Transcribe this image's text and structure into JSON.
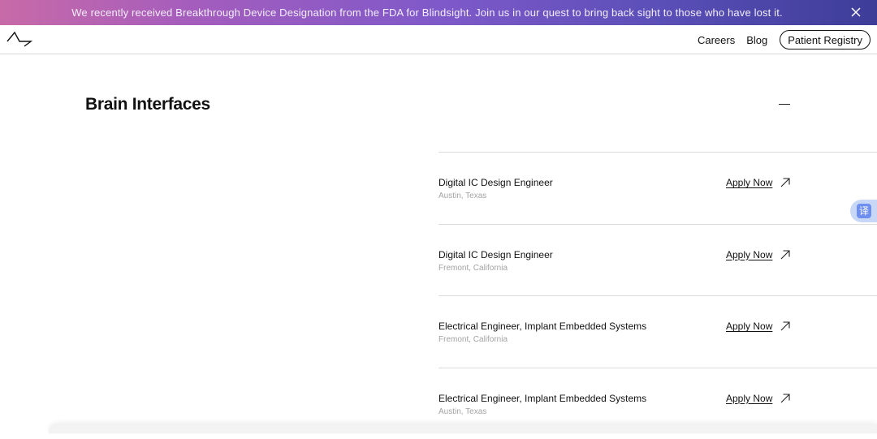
{
  "banner": {
    "text": "We recently received Breakthrough Device Designation from the FDA for Blindsight. Join us in our quest to bring back sight to those who have lost it.",
    "close_icon": "close-icon"
  },
  "nav": {
    "logo_icon": "neuralink-logo-icon",
    "links": [
      "Careers",
      "Blog"
    ],
    "cta": "Patient Registry"
  },
  "section": {
    "title": "Brain Interfaces",
    "toggle_icon": "minus-icon"
  },
  "jobs": [
    {
      "title": "Digital IC Design Engineer",
      "location": "Austin, Texas",
      "apply": "Apply Now"
    },
    {
      "title": "Digital IC Design Engineer",
      "location": "Fremont, California",
      "apply": "Apply Now"
    },
    {
      "title": "Electrical Engineer, Implant Embedded Systems",
      "location": "Fremont, California",
      "apply": "Apply Now"
    },
    {
      "title": "Electrical Engineer, Implant Embedded Systems",
      "location": "Austin, Texas",
      "apply": "Apply Now"
    }
  ],
  "translate": {
    "glyph": "译",
    "icon": "translate-icon"
  },
  "colors": {
    "banner_start": "#c86aa8",
    "banner_end": "#3d3d98",
    "translate_accent": "#6f8ff0"
  }
}
